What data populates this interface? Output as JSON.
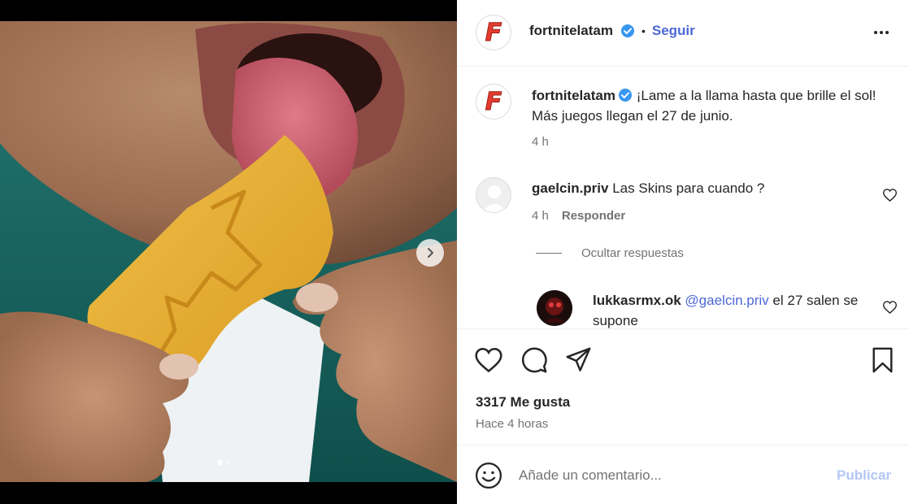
{
  "post": {
    "author": "fortnitelatam",
    "follow_label": "Seguir",
    "separator": "•",
    "caption_text": "¡Lame a la llama hasta que brille el sol! Más juegos llegan el 27 de junio.",
    "caption_time": "4 h",
    "avatar_letter": "F"
  },
  "comments": [
    {
      "user": "gaelcin.priv",
      "text": "Las Skins para cuando ?",
      "time": "4 h",
      "reply_label": "Responder"
    }
  ],
  "hide_replies_label": "Ocultar respuestas",
  "reply": {
    "user": "lukkasrmx.ok",
    "mention": "@gaelcin.priv",
    "text": "el 27 salen se supone"
  },
  "engagement": {
    "likes": "3317 Me gusta",
    "time_ago": "Hace 4 horas"
  },
  "composer": {
    "placeholder": "Añade un comentario...",
    "publish_label": "Publicar"
  },
  "icons": {
    "verified": "verified-badge-icon",
    "more": "more-options-icon",
    "like": "heart-icon",
    "comment": "comment-bubble-icon",
    "share": "paper-plane-icon",
    "save": "bookmark-icon",
    "emoji": "emoji-smiley-icon",
    "next": "chevron-right-icon"
  },
  "colors": {
    "accent": "#4c68d7",
    "verified": "#3897f0",
    "publish_disabled": "#b2c6f6",
    "muted_text": "#737373"
  },
  "carousel": {
    "total_slides": 2,
    "current_slide": 1
  }
}
